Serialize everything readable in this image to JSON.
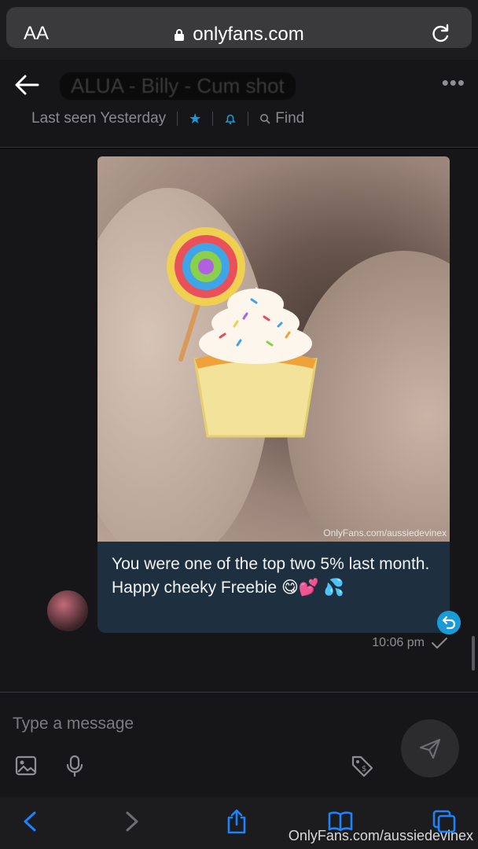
{
  "browser": {
    "text_size_label": "AA",
    "host": "onlyfans.com"
  },
  "chat": {
    "title": "ALUA - Billy - Cum shot",
    "last_seen": "Last seen Yesterday",
    "find_label": "Find"
  },
  "message": {
    "image_watermark": "OnlyFans.com/aussiedevinex",
    "text": "You were one of the top two 5% last month. Happy cheeky Freebie 😋💕 💦",
    "time": "10:06 pm"
  },
  "composer": {
    "placeholder": "Type a message"
  },
  "footer_watermark": "OnlyFans.com/aussiedevinex",
  "colors": {
    "accent": "#1a9bd8",
    "bubble": "#1e3040",
    "background": "#161618"
  }
}
